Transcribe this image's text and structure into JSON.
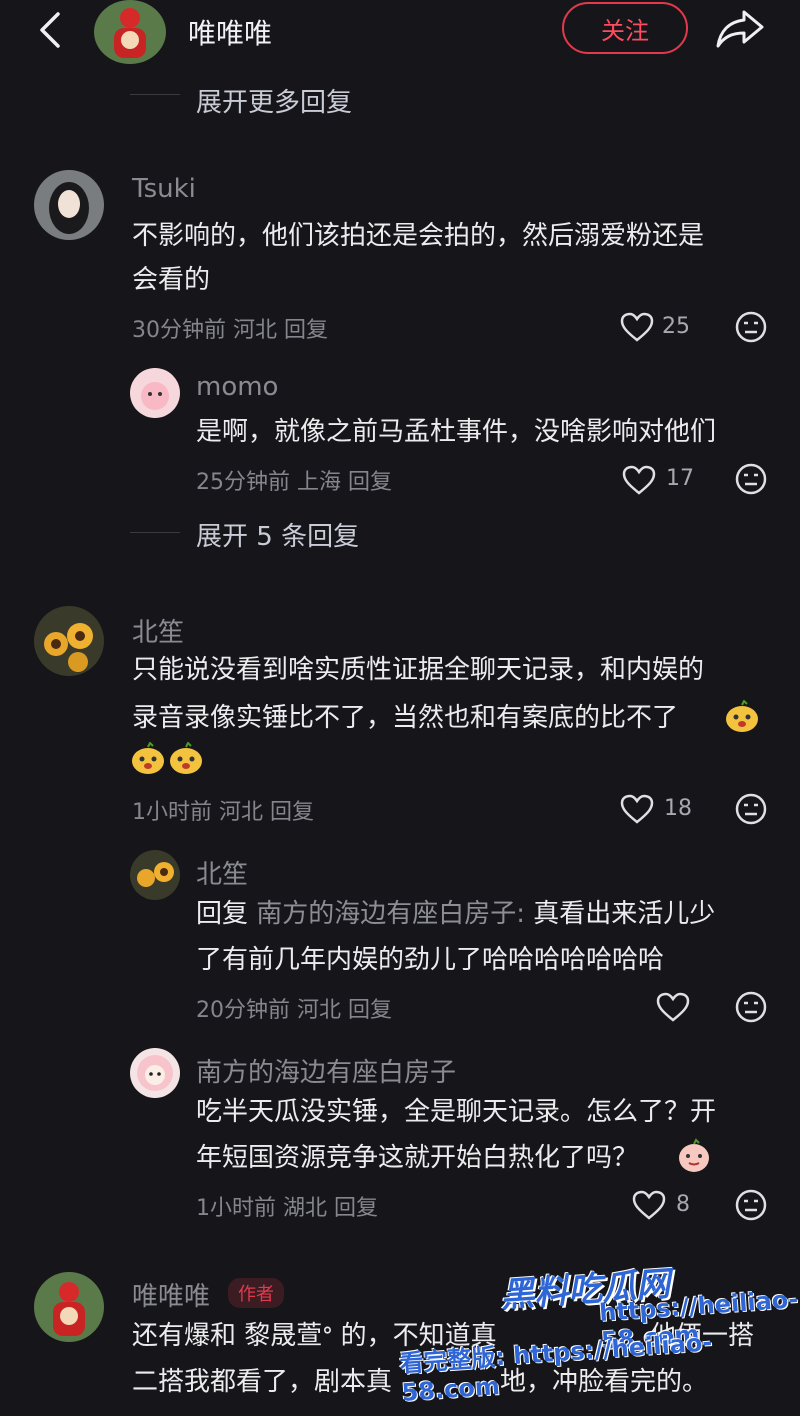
{
  "header": {
    "title": "唯唯唯",
    "follow_label": "关注"
  },
  "expand_more_top": "展开更多回复",
  "comments": [
    {
      "user": "Tsuki",
      "text1": "不影响的，他们该拍还是会拍的，然后溺爱粉还是",
      "text2": "会看的",
      "meta": "30分钟前 河北 回复",
      "likes": "25"
    },
    {
      "user": "momo",
      "text1": "是啊，就像之前马孟杜事件，没啥影响对他们",
      "meta": "25分钟前 上海 回复",
      "likes": "17"
    },
    {
      "expand": "展开 5 条回复"
    },
    {
      "user": "北笙",
      "text1": "只能说没看到啥实质性证据全聊天记录，和内娱的",
      "text2": "录音录像实锤比不了，当然也和有案底的比不了",
      "meta": "1小时前 河北 回复",
      "likes": "18"
    },
    {
      "user": "北笙",
      "reply_prefix": "回复",
      "reply_to": "南方的海边有座白房子:",
      "text1": " 真看出来活儿少",
      "text2": "了有前几年内娱的劲儿了哈哈哈哈哈哈哈",
      "meta": "20分钟前 河北 回复"
    },
    {
      "user": "南方的海边有座白房子",
      "text1": "吃半天瓜没实锤，全是聊天记录。怎么了？开",
      "text2": "年短国资源竞争这就开始白热化了吗？",
      "meta": "1小时前 湖北 回复",
      "likes": "8"
    },
    {
      "user": "唯唯唯",
      "tag": "作者",
      "text1": "还有爆和 黎晟萱ᐤ 的，不知道真",
      "text1b": "他俩一搭",
      "text2": "二搭我都看了，剧本真",
      "text2b": "地，冲脸看完的。"
    }
  ],
  "watermark": {
    "brand": "黑料吃瓜网",
    "url": "https://heiliao-58.com",
    "full": "看完整版: https://heiliao-58.com"
  },
  "colors": {
    "background": "#16161a",
    "accent": "#e23a4c",
    "watermark": "#2f66d6"
  }
}
